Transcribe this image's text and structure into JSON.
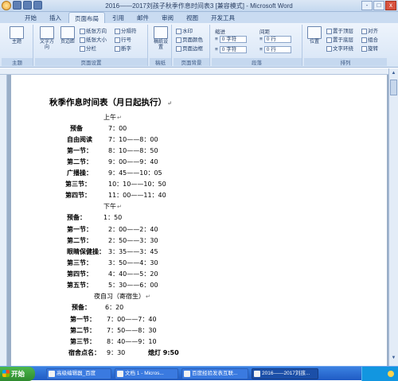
{
  "window": {
    "title": "2016——2017刘孩子秋季作息时间表3 [兼容模式] - Microsoft Word",
    "controls": [
      "-",
      "□",
      "x"
    ]
  },
  "ribbon": {
    "tabs": [
      {
        "label": "开始",
        "active": false
      },
      {
        "label": "插入",
        "active": false
      },
      {
        "label": "页面布局",
        "active": true
      },
      {
        "label": "引用",
        "active": false
      },
      {
        "label": "邮件",
        "active": false
      },
      {
        "label": "审阅",
        "active": false
      },
      {
        "label": "视图",
        "active": false
      },
      {
        "label": "开发工具",
        "active": false
      }
    ],
    "groups": {
      "theme": {
        "label": "主题",
        "buttons": [
          "主题"
        ]
      },
      "page_setup": {
        "label": "页面设置",
        "big_buttons": [
          "文字方向",
          "页边距"
        ],
        "small_buttons": [
          "纸张方向",
          "纸张大小",
          "分栏",
          "分隔符",
          "行号",
          "断字"
        ]
      },
      "draft": {
        "label": "稿纸",
        "buttons": [
          "稿纸设置"
        ]
      },
      "page_background": {
        "label": "页面背景",
        "buttons": [
          "水印",
          "页面颜色",
          "页面边框"
        ]
      },
      "paragraph": {
        "label": "段落",
        "indent_header": "缩进",
        "spacing_header": "间距",
        "left_value": "0 字符",
        "right_value": "0 字符",
        "before_value": "0 行",
        "after_value": "0 行"
      },
      "arrange": {
        "label": "排列",
        "buttons": [
          "位置",
          "置于顶层",
          "置于底层",
          "文字环绕",
          "对齐",
          "组合",
          "旋转"
        ]
      }
    }
  },
  "document": {
    "title": "秋季作息时间表（月日起执行）",
    "sections": [
      {
        "heading": "上午",
        "rows": [
          {
            "label": "预备",
            "time": "7：00"
          },
          {
            "label": "自由阅读",
            "time": "7：10——8：00"
          },
          {
            "label": "第一节：",
            "time": "8：10——8：50"
          },
          {
            "label": "第二节：",
            "time": "9：00——9：40"
          },
          {
            "label": "广播操：",
            "time": "9：45——10：05"
          },
          {
            "label": "第三节：",
            "time": "10：10——10：50"
          },
          {
            "label": "第四节：",
            "time": "11：00——11：40"
          }
        ]
      },
      {
        "heading": "下午",
        "rows": [
          {
            "label": "预备：",
            "time": "1：50"
          },
          {
            "label": "第一节：",
            "time": "2：00——2：40"
          },
          {
            "label": "第二节：",
            "time": "2：50——3：30"
          },
          {
            "label": "眼睛保健操：",
            "time": "3：35——3：45"
          },
          {
            "label": "第三节：",
            "time": "3：50——4：30"
          },
          {
            "label": "第四节：",
            "time": "4：40——5：20"
          },
          {
            "label": "第五节：",
            "time": "5：30——6：00"
          }
        ]
      },
      {
        "heading": "夜自习（寄宿生）",
        "rows": [
          {
            "label": "预备：",
            "time": "6：20"
          },
          {
            "label": "第一节：",
            "time": "7：00——7：40"
          },
          {
            "label": "第二节：",
            "time": "7：50——8：30"
          },
          {
            "label": "第三节：",
            "time": "8：40——9：10"
          },
          {
            "label": "宿舍点名：",
            "time": "9：30",
            "extra": "熄灯 9:50"
          }
        ]
      }
    ]
  },
  "taskbar": {
    "start_label": "开始",
    "items": [
      {
        "label": "高级编辑器_百度",
        "active": false
      },
      {
        "label": "文档 1 - Micros...",
        "active": false
      },
      {
        "label": "百度经验发表互联...",
        "active": false
      },
      {
        "label": "2016——2017刘孩...",
        "active": true
      }
    ]
  }
}
